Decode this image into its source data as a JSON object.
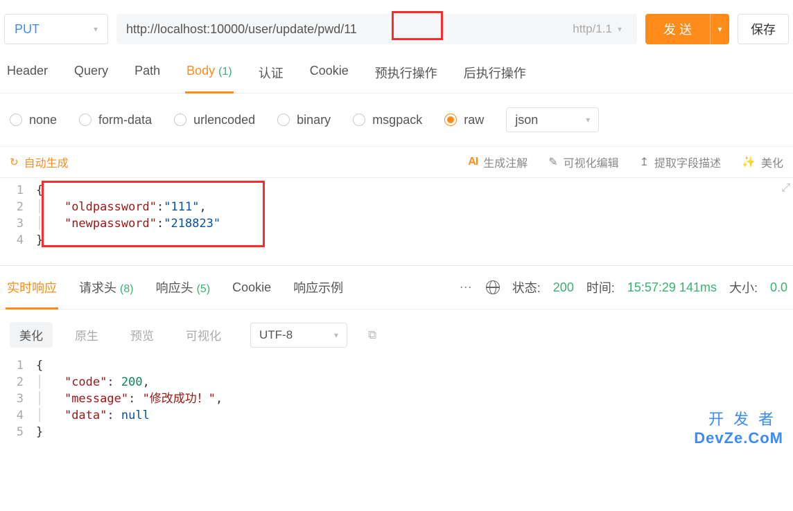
{
  "request": {
    "method": "PUT",
    "url": "http://localhost:10000/user/update/pwd/11",
    "http_version": "http/1.1",
    "send_label": "发 送",
    "save_label": "保存",
    "tabs": {
      "header": "Header",
      "query": "Query",
      "path": "Path",
      "body": "Body",
      "body_count": "(1)",
      "auth": "认证",
      "cookie": "Cookie",
      "pre": "预执行操作",
      "post": "后执行操作"
    },
    "body_types": {
      "none": "none",
      "formdata": "form-data",
      "urlencoded": "urlencoded",
      "binary": "binary",
      "msgpack": "msgpack",
      "raw": "raw"
    },
    "body_format": "json",
    "toolbar": {
      "autogen": "自动生成",
      "ai_label": "生成注解",
      "visual_edit": "可视化编辑",
      "extract": "提取字段描述",
      "beautify": "美化"
    },
    "body_json": {
      "lines": [
        {
          "n": "1",
          "t": "{"
        },
        {
          "n": "2",
          "t": "    \"oldpassword\":\"111\","
        },
        {
          "n": "3",
          "t": "    \"newpassword\":\"218823\""
        },
        {
          "n": "4",
          "t": "}"
        }
      ],
      "tokens": {
        "k1": "\"oldpassword\"",
        "v1": "\"111\"",
        "k2": "\"newpassword\"",
        "v2": "\"218823\""
      }
    }
  },
  "response": {
    "tabs": {
      "realtime": "实时响应",
      "req_headers": "请求头",
      "req_headers_count": "(8)",
      "resp_headers": "响应头",
      "resp_headers_count": "(5)",
      "cookie": "Cookie",
      "example": "响应示例",
      "more": "⋯"
    },
    "meta": {
      "status_label": "状态:",
      "status_code": "200",
      "time_label": "时间:",
      "time_value": "15:57:29 141ms",
      "size_label": "大小:",
      "size_value": "0.0"
    },
    "subtabs": {
      "beautify": "美化",
      "raw": "原生",
      "preview": "预览",
      "visual": "可视化"
    },
    "encoding": "UTF-8",
    "body": {
      "tokens": {
        "k_code": "\"code\"",
        "v_code": "200",
        "k_message": "\"message\"",
        "v_message": "\"修改成功！\"",
        "k_data": "\"data\"",
        "v_data": "null"
      }
    }
  },
  "watermark": {
    "l1": "开发者",
    "l2": "DevZe.CoM"
  }
}
